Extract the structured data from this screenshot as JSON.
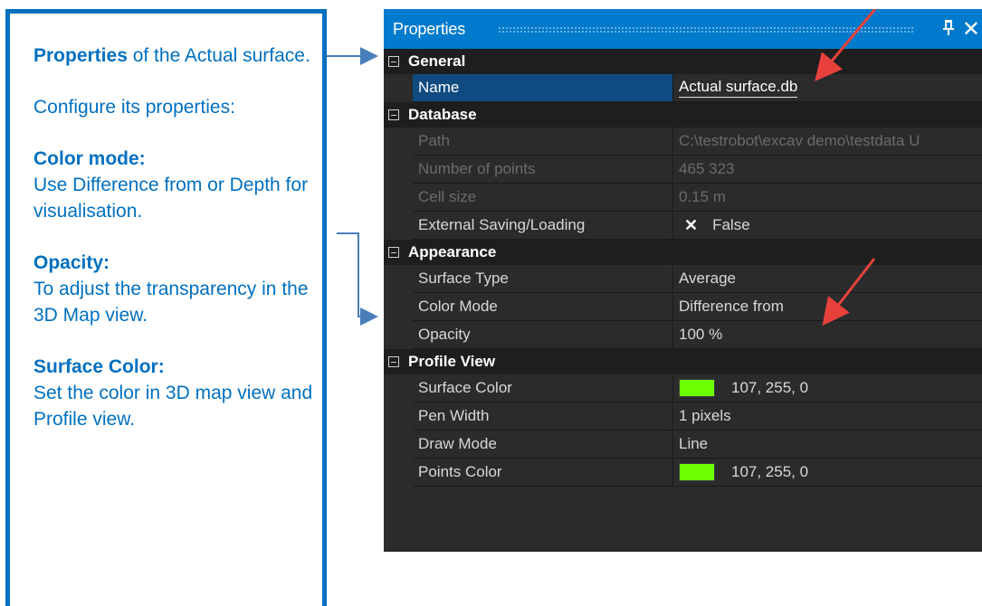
{
  "callout": {
    "p1_bold": "Properties",
    "p1_rest": " of the Actual surface.",
    "p2": "Configure its properties:",
    "p3_bold": "Color mode:",
    "p3_rest": "Use Difference from or Depth for visualisation.",
    "p4_bold": "Opacity:",
    "p4_rest": "To adjust the transparency in the 3D Map view.",
    "p5_bold": "Surface Color:",
    "p5_rest": "Set the color in 3D map view and Profile view."
  },
  "panel": {
    "title": "Properties",
    "pin_icon": "pin-icon",
    "close_icon": "close-icon",
    "close_glyph": "✕",
    "pin_glyph": "⊥"
  },
  "grid": {
    "general": {
      "label": "General",
      "name_label": "Name",
      "name_value": "Actual surface.db"
    },
    "database": {
      "label": "Database",
      "path_label": "Path",
      "path_value": "C:\\testrobot\\excav demo\\testdata U",
      "points_label": "Number of points",
      "points_value": "465 323",
      "cell_label": "Cell size",
      "cell_value": "0.15 m",
      "ext_label": "External Saving/Loading",
      "ext_value": "False"
    },
    "appearance": {
      "label": "Appearance",
      "type_label": "Surface Type",
      "type_value": "Average",
      "color_mode_label": "Color Mode",
      "color_mode_value": "Difference from",
      "opacity_label": "Opacity",
      "opacity_value": "100 %"
    },
    "profile": {
      "label": "Profile View",
      "surface_color_label": "Surface Color",
      "surface_color_value": "107, 255, 0",
      "pen_label": "Pen Width",
      "pen_value": "1 pixels",
      "draw_label": "Draw Mode",
      "draw_value": "Line",
      "points_color_label": "Points Color",
      "points_color_value": "107, 255, 0"
    }
  },
  "colors": {
    "accent_blue": "#0070c0",
    "titlebar": "#007acc",
    "surface_color": "#6bff00",
    "annotation_arrow": "#e8413c"
  }
}
